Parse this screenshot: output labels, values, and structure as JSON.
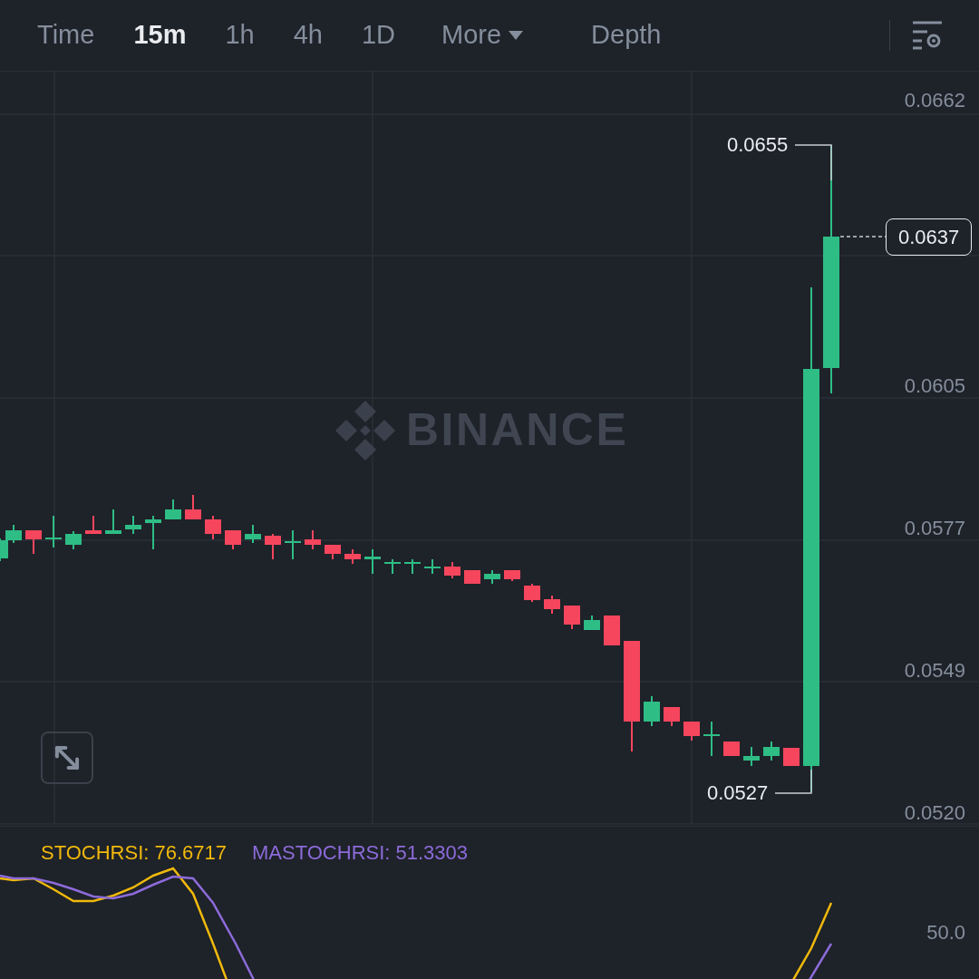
{
  "toolbar": {
    "tabs": [
      {
        "label": "Time",
        "selected": false,
        "kind": "tab"
      },
      {
        "label": "15m",
        "selected": true,
        "kind": "tab"
      },
      {
        "label": "1h",
        "selected": false,
        "kind": "tab"
      },
      {
        "label": "4h",
        "selected": false,
        "kind": "tab"
      },
      {
        "label": "1D",
        "selected": false,
        "kind": "tab"
      },
      {
        "label": "More",
        "selected": false,
        "kind": "dropdown"
      },
      {
        "label": "Depth",
        "selected": false,
        "kind": "tab"
      }
    ]
  },
  "chart": {
    "watermark": "BINANCE",
    "price_axis": [
      "0.0662",
      "0.0605",
      "0.0577",
      "0.0549",
      "0.0520"
    ],
    "high_label": "0.0655",
    "current_price": "0.0637",
    "low_label": "0.0527"
  },
  "indicator": {
    "stochrsi": "STOCHRSI: 76.6717",
    "mastochrsi": "MASTOCHRSI: 51.3303",
    "axis_label": "50.0"
  }
}
